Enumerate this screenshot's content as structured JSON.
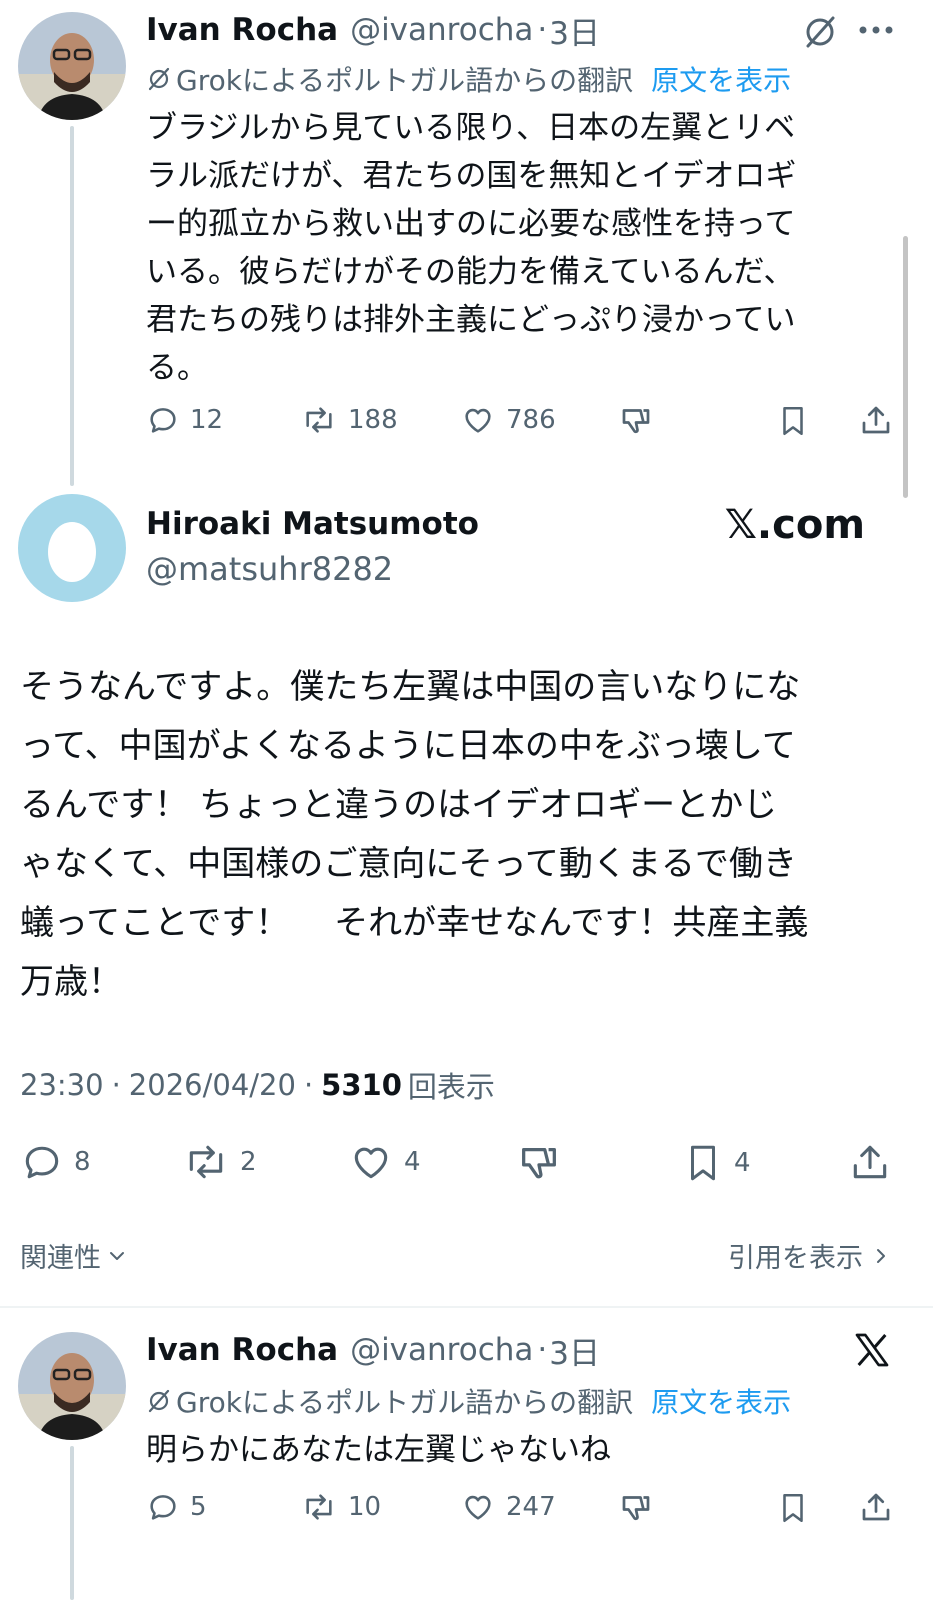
{
  "tweet1": {
    "name": "Ivan Rocha",
    "handle": "@ivanrocha",
    "sep": "·",
    "time": "3日",
    "translation_note": "Grokによるポルトガル語からの翻訳",
    "show_original": "原文を表示",
    "lines": [
      "ブラジルから見ている限り、日本の左翼とリベ",
      "ラル派だけが、君たちの国を無知とイデオロギ",
      "ー的孤立から救い出すのに必要な感性を持って",
      "いる。彼らだけがその能力を備えているんだ、",
      "君たちの残りは排外主義にどっぷり浸かってい",
      "る。"
    ],
    "replies": "12",
    "reposts": "188",
    "likes": "786"
  },
  "main_tweet": {
    "name": "Hiroaki Matsumoto",
    "handle": "@matsuhr8282",
    "source": "𝕏.com",
    "lines": [
      "そうなんですよ。僕たち左翼は中国の言いなりにな",
      "って、中国がよくなるように日本の中をぶっ壊して",
      "るんです！ ちょっと違うのはイデオロギーとかじ",
      "ゃなくて、中国様のご意向にそって動くまるで働き",
      "蟻ってことです！　 それが幸せなんです！共産主義",
      "万歳！"
    ],
    "time": "23:30",
    "sep": "·",
    "date": "2026/04/20",
    "views": "5310",
    "views_label": "回表示",
    "replies": "8",
    "reposts": "2",
    "likes": "4",
    "bookmarks": "4",
    "relevance": "関連性",
    "show_quotes": "引用を表示"
  },
  "tweet3": {
    "name": "Ivan Rocha",
    "handle": "@ivanrocha",
    "sep": "·",
    "time": "3日",
    "translation_note": "Grokによるポルトガル語からの翻訳",
    "show_original": "原文を表示",
    "text": "明らかにあなたは左翼じゃないね",
    "replies": "5",
    "reposts": "10",
    "likes": "247"
  },
  "colors": {
    "text": "#0f1419",
    "muted": "#536471",
    "link": "#1d9bf0",
    "line": "#cfd9de"
  }
}
